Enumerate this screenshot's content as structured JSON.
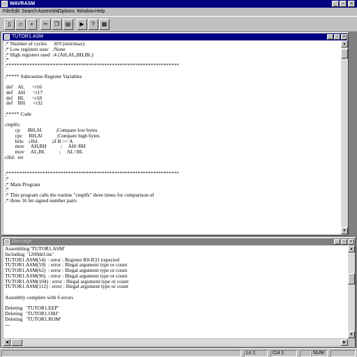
{
  "app": {
    "title": "WAVRASM"
  },
  "menu": [
    "File",
    "Edit",
    "Search",
    "Assemble",
    "Options",
    "Window",
    "Help"
  ],
  "toolbar": {
    "buttons": [
      {
        "name": "new-file-button",
        "glyph": "▯"
      },
      {
        "name": "open-file-button",
        "glyph": "▱"
      },
      {
        "name": "save-file-button",
        "glyph": "▪"
      },
      {
        "name": "cut-button",
        "glyph": "✂"
      },
      {
        "name": "copy-button",
        "glyph": "❐"
      },
      {
        "name": "paste-button",
        "glyph": "▤"
      },
      {
        "name": "assemble-button",
        "glyph": "▶"
      },
      {
        "name": "help-button",
        "glyph": "?"
      },
      {
        "name": "print-button",
        "glyph": "▦"
      }
    ]
  },
  "editor": {
    "title": "TUTOR1.ASM",
    "lines": [
      ";* Number of cycles     :8/9 (min/max)",
      ";* Low registers usec   :None",
      ";* High registers used  :4 (AH,AL,BH,BL)",
      ";*",
      ";*******************************************************************",
      "",
      ";***** Subroutine Register Variables",
      "",
      " def    AL      =r16",
      " def    AH      =r17",
      " def    BL      =r18",
      " def    BH      =r32",
      "",
      ";***** Code",
      "",
      "cmplfs:",
      "        cp      BH,AI           ;Compare low bytes",
      "        cpc     BH,Al           ;Compare high bytes",
      "        brlo    clfsl           ;if B >= A",
      "        mov     AH,BH           ;     AH=BH",
      "        mov     AL,BL           ;     AL=BL",
      "clfsl:  ret",
      "",
      "",
      ";*******************************************************************",
      ";*",
      ";* Main Program",
      ";*",
      ";* This program calls the routine \"cmplfs\" three times for comparison of",
      ";* three 16 bit signed number pairs"
    ]
  },
  "messages": {
    "title": "Message",
    "lines": [
      "Assembling 'TUTOR1.ASM'",
      "Including  '1200def.inc'",
      "TUTOR1.ASM(54)  : error : Register R0-R31 expected",
      "TUTOR1.ASM(59)  : error : Illegal argument type or count",
      "TUTOR1.ASM(62)  : error : Illegal argument type or count",
      "TUTOR1.ASM(96)  : error : Illegal argument type or count",
      "TUTOR1.ASM(104) : error : Illegal argument type or count",
      "TUTOR1.ASM(112) : error : Illegal argument type or count",
      "",
      "Assembly complete with 6 errors",
      "",
      "Deleting   'TUTOR1.EEP'",
      "Deleting   'TUTOR1.OBJ'",
      "Deleting   'TUTOR1.ROM'",
      "---"
    ]
  },
  "status": {
    "line": "Ln 1",
    "col": "Col 1",
    "mode": "NUM"
  },
  "colors": {
    "active_title": "#000080",
    "inactive_title": "#808080",
    "face": "#c0c0c0"
  }
}
